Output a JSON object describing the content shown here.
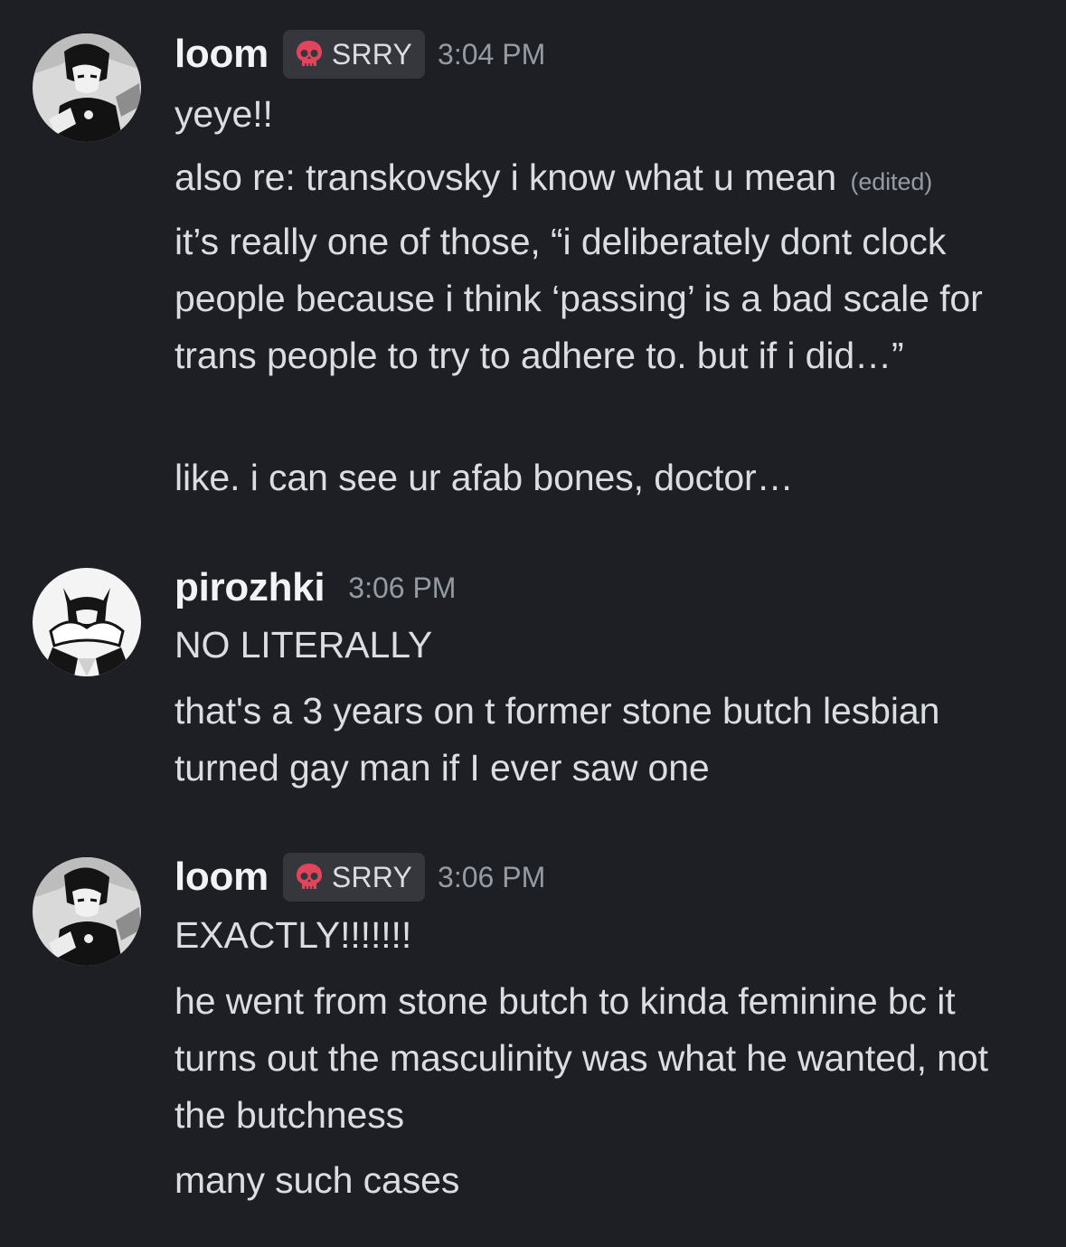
{
  "colors": {
    "background": "#1e1f24",
    "username": "#f2f3f5",
    "text": "#dbdee1",
    "muted": "#949ba4",
    "tag_background": "#35373c",
    "tag_icon": "#e2445c"
  },
  "messages": [
    {
      "author": "loom",
      "tag": {
        "icon": "skull-icon",
        "text": "SRRY"
      },
      "time": "3:04 PM",
      "lines": [
        {
          "text": "yeye!!"
        },
        {
          "text": "also re: transkovsky i know what u mean",
          "edited": "(edited)"
        },
        {
          "text": "it’s really one of those, “i deliberately dont clock people because i think ‘passing’ is a bad scale for trans people to try to adhere to. but if i did…”"
        },
        {
          "text": "like. i can see ur afab bones, doctor…"
        }
      ]
    },
    {
      "author": "pirozhki",
      "time": "3:06 PM",
      "lines": [
        {
          "text": "NO LITERALLY"
        },
        {
          "text": "that's a 3 years on t former stone butch lesbian turned gay man if I ever saw one"
        }
      ]
    },
    {
      "author": "loom",
      "tag": {
        "icon": "skull-icon",
        "text": "SRRY"
      },
      "time": "3:06 PM",
      "lines": [
        {
          "text": "EXACTLY!!!!!!!"
        },
        {
          "text": "he went from stone butch to kinda feminine bc it turns out the masculinity was what he wanted, not the butchness"
        },
        {
          "text": "many such cases"
        }
      ]
    }
  ]
}
